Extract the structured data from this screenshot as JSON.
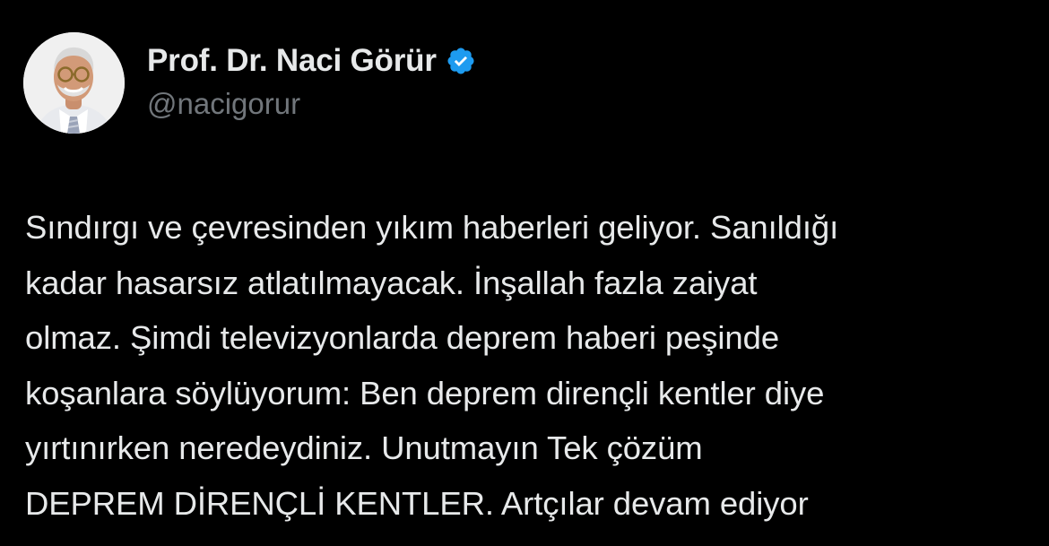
{
  "theme": {
    "background": "#000000",
    "text": "#e7e9ea",
    "secondary_text": "#71767b",
    "verified_badge": "#1d9bf0"
  },
  "author": {
    "display_name": "Prof. Dr. Naci Görür",
    "handle": "@nacigorur",
    "verified": true,
    "avatar_icon": "profile-photo"
  },
  "tweet": {
    "lines": [
      "Sındırgı ve çevresinden yıkım haberleri geliyor. Sanıldığı",
      "kadar hasarsız atlatılmayacak. İnşallah fazla zaiyat",
      "olmaz. Şimdi televizyonlarda deprem haberi peşinde",
      "koşanlara söylüyorum: Ben deprem dirençli kentler diye",
      "yırtınırken neredeydiniz. Unutmayın Tek çözüm",
      "DEPREM DİRENÇLİ KENTLER. Artçılar devam ediyor"
    ]
  }
}
